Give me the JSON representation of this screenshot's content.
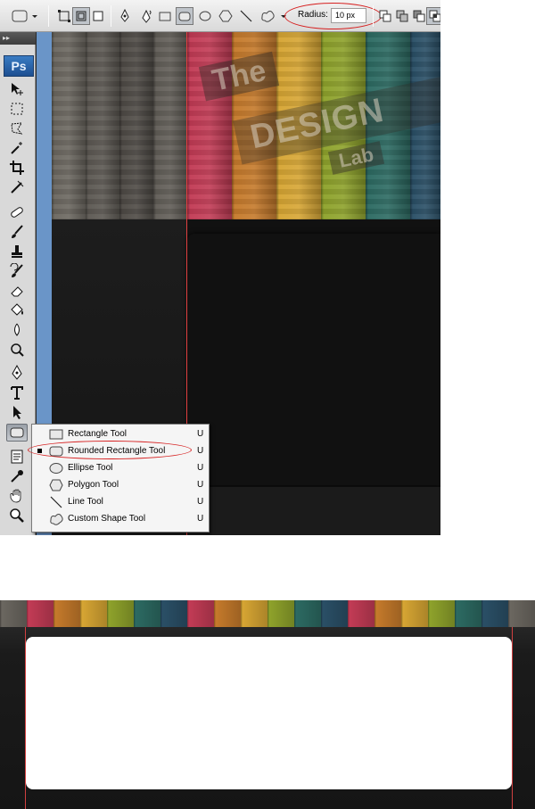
{
  "options_bar": {
    "radius_label": "Radius:",
    "radius_value": "10 px"
  },
  "tools_panel": {
    "logo": "Ps",
    "collapse_glyph": "▸▸"
  },
  "canvas": {
    "watermark": {
      "the": "The",
      "design": "DESIGN",
      "lab": "Lab"
    },
    "plank_colors": [
      "#6b6760",
      "#5c5852",
      "#4e4a45",
      "#615d57",
      "#c23b55",
      "#c57a2b",
      "#d6a533",
      "#8ea22b",
      "#2c6a62",
      "#2a4f66"
    ]
  },
  "flyout_menu": {
    "items": [
      {
        "label": "Rectangle Tool",
        "shortcut": "U",
        "icon": "rectangle-icon",
        "selected": false
      },
      {
        "label": "Rounded Rectangle Tool",
        "shortcut": "U",
        "icon": "rounded-rectangle-icon",
        "selected": true
      },
      {
        "label": "Ellipse Tool",
        "shortcut": "U",
        "icon": "ellipse-icon",
        "selected": false
      },
      {
        "label": "Polygon Tool",
        "shortcut": "U",
        "icon": "polygon-icon",
        "selected": false
      },
      {
        "label": "Line Tool",
        "shortcut": "U",
        "icon": "line-icon",
        "selected": false
      },
      {
        "label": "Custom Shape Tool",
        "shortcut": "U",
        "icon": "custom-shape-icon",
        "selected": false
      }
    ]
  },
  "colors": {
    "highlight": "#d62020",
    "guide": "#e04040",
    "tools_blue": "#6a95c8"
  }
}
